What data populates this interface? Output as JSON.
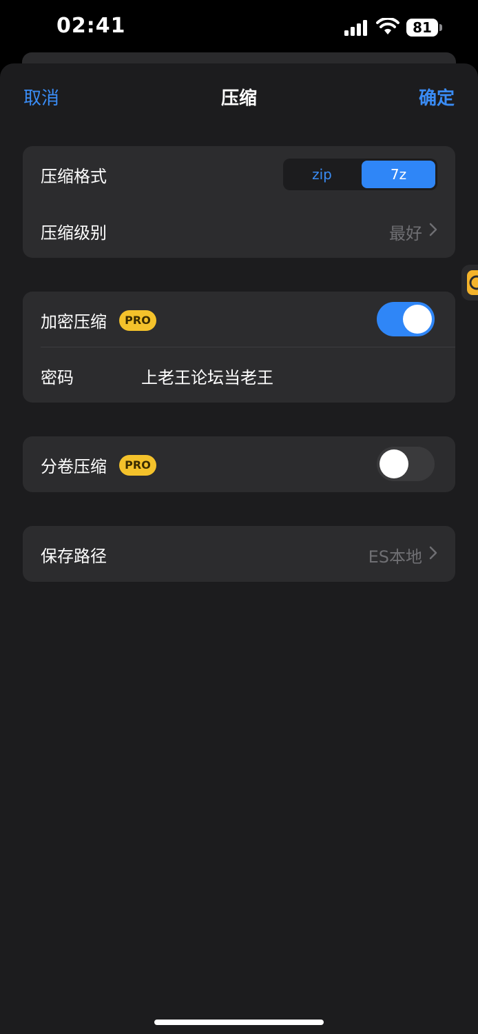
{
  "status_bar": {
    "time": "02:41",
    "battery": "81",
    "icons": [
      "signal-icon",
      "wifi-icon",
      "battery-icon"
    ]
  },
  "nav": {
    "cancel_label": "取消",
    "title": "压缩",
    "confirm_label": "确定"
  },
  "format_card": {
    "format_label": "压缩格式",
    "format_options": [
      "zip",
      "7z"
    ],
    "format_selected": "7z",
    "level_label": "压缩级别",
    "level_value": "最好"
  },
  "encryption_card": {
    "encrypt_label": "加密压缩",
    "pro_badge": "PRO",
    "encrypt_enabled": true,
    "password_label": "密码",
    "password_value": "上老王论坛当老王"
  },
  "split_card": {
    "split_label": "分卷压缩",
    "pro_badge": "PRO",
    "split_enabled": false
  },
  "save_card": {
    "path_label": "保存路径",
    "path_value": "ES本地"
  },
  "colors": {
    "accent": "#2f86f7",
    "link": "#3a8cf5",
    "pro_badge": "#f4c22b",
    "sheet_bg": "#1c1c1e",
    "card_bg": "#2c2c2e",
    "secondary_text": "#6f6f73"
  }
}
